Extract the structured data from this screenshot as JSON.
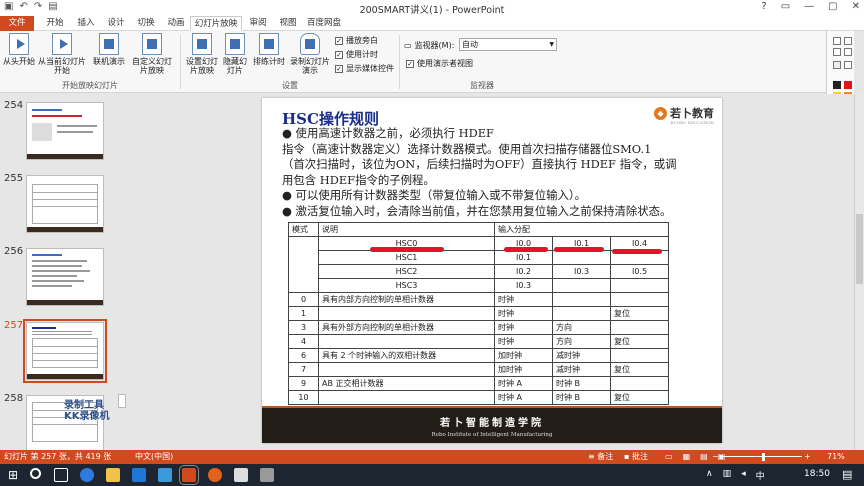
{
  "window": {
    "title": "200SMART讲义(1) - PowerPoint",
    "qat_icons": [
      "save-icon",
      "undo-icon",
      "redo-icon",
      "present-icon"
    ],
    "controls": [
      "?",
      "▭",
      "—",
      "▢",
      "✕"
    ]
  },
  "tabs": [
    {
      "label": "文件",
      "type": "file"
    },
    {
      "label": "开始"
    },
    {
      "label": "插入"
    },
    {
      "label": "设计"
    },
    {
      "label": "切换"
    },
    {
      "label": "动画"
    },
    {
      "label": "幻灯片放映",
      "active": true
    },
    {
      "label": "审阅"
    },
    {
      "label": "视图"
    },
    {
      "label": "百度网盘"
    }
  ],
  "ribbon": {
    "buttons": {
      "from_start": "从头开始",
      "from_current": "从当前幻灯片开始",
      "online": "联机演示",
      "custom": "自定义幻灯片放映",
      "setup": "设置幻灯片放映",
      "hide": "隐藏幻灯片",
      "rehearse": "排练计时",
      "record": "录制幻灯片演示"
    },
    "checkboxes": {
      "narration": "播放旁白",
      "timings": "使用计时",
      "media_controls": "显示媒体控件"
    },
    "monitor": {
      "label": "监视器(M):",
      "value": "自动",
      "presenter_view": "使用演示者视图"
    },
    "groups": {
      "start": "开始放映幻灯片",
      "setup": "设置",
      "monitors": "监视器"
    }
  },
  "slides_panel": {
    "numbers": [
      "254",
      "255",
      "256",
      "257",
      "258"
    ],
    "selected": "257",
    "watermark_line1": "录制工具",
    "watermark_line2": "KK录像机"
  },
  "slide": {
    "title": "HSC操作规则",
    "logo_text": "若卜教育",
    "logo_sub": "RUOBU EDUCATION",
    "body_lines": [
      "● 使用高速计数器之前，必须执行 HDEF",
      "指令（高速计数器定义）选择计数器模式。使用首次扫描存储器位SMO.1",
      "（首次扫描时，该位为ON，后续扫描时为OFF）直接执行 HDEF 指令，或调",
      "用包含 HDEF指令的子例程。",
      "● 可以使用所有计数器类型（带复位输入或不带复位输入）。",
      "● 激活复位输入时，会清除当前值，并在您禁用复位输入之前保持清除状态。"
    ],
    "table": {
      "headers": {
        "mode": "模式",
        "desc": "说明",
        "io": "输入分配"
      },
      "hsc_rows": [
        [
          "HSC0",
          "I0.0",
          "I0.1",
          "I0.4"
        ],
        [
          "HSC1",
          "I0.1",
          "",
          ""
        ],
        [
          "HSC2",
          "I0.2",
          "I0.3",
          "I0.5"
        ],
        [
          "HSC3",
          "I0.3",
          "",
          ""
        ]
      ],
      "mode_rows": [
        {
          "mode": "0",
          "desc": "具有内部方向控制的单相计数器",
          "a": "时钟",
          "b": "",
          "c": ""
        },
        {
          "mode": "1",
          "desc": "",
          "a": "时钟",
          "b": "",
          "c": "复位"
        },
        {
          "mode": "3",
          "desc": "具有外部方向控制的单相计数器",
          "a": "时钟",
          "b": "方向",
          "c": ""
        },
        {
          "mode": "4",
          "desc": "",
          "a": "时钟",
          "b": "方向",
          "c": "复位"
        },
        {
          "mode": "6",
          "desc": "具有 2 个时钟输入的双相计数器",
          "a": "加时钟",
          "b": "减时钟",
          "c": ""
        },
        {
          "mode": "7",
          "desc": "",
          "a": "加时钟",
          "b": "减时钟",
          "c": "复位"
        },
        {
          "mode": "9",
          "desc": "AB 正交相计数器",
          "a": "时钟 A",
          "b": "时钟 B",
          "c": ""
        },
        {
          "mode": "10",
          "desc": "",
          "a": "时钟 A",
          "b": "时钟 B",
          "c": "复位"
        }
      ]
    },
    "footer_cn": "若卜智能制造学院",
    "footer_en": "Robo Institute of Intelligent Manufacturing"
  },
  "statusbar": {
    "slide_info": "幻灯片 第 257 张，共 419 张",
    "language": "中文(中国)",
    "notes": "备注",
    "comments": "批注",
    "zoom": "71%"
  },
  "taskbar": {
    "time": "18:50",
    "ime": "中"
  }
}
